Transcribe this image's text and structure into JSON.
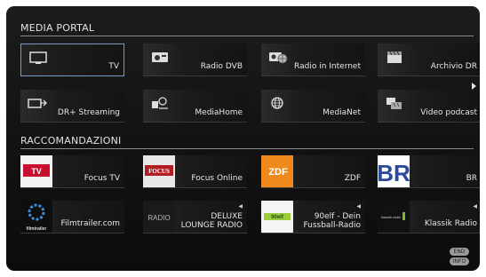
{
  "sections": {
    "portal_title": "MEDIA PORTAL",
    "recommend_title": "RACCOMANDAZIONI"
  },
  "portal_tiles": [
    {
      "label": "TV",
      "icon": "tv-icon"
    },
    {
      "label": "Radio DVB",
      "icon": "radio-icon"
    },
    {
      "label": "Radio in Internet",
      "icon": "internet-radio-icon"
    },
    {
      "label": "Archivio DR",
      "icon": "clapper-icon"
    },
    {
      "label": "DR+ Streaming",
      "icon": "streaming-icon"
    },
    {
      "label": "MediaHome",
      "icon": "mediahome-icon"
    },
    {
      "label": "MediaNet",
      "icon": "globe-icon"
    },
    {
      "label": "Video podcast",
      "icon": "podcast-icon"
    }
  ],
  "recommend_tiles": [
    {
      "label": "Focus TV",
      "thumb_text": "TV"
    },
    {
      "label": "Focus Online",
      "thumb_text": "FOCUS"
    },
    {
      "label": "ZDF",
      "thumb_text": "ZDF"
    },
    {
      "label": "BR",
      "thumb_text": "BR"
    },
    {
      "label": "Filmtrailer.com",
      "thumb_text": "filmtrailer"
    },
    {
      "label_line1": "DELUXE",
      "label_line2": "LOUNGE RADIO",
      "thumb_text": "RADIO"
    },
    {
      "label_line1": "90elf - Dein",
      "label_line2": "Fussball-Radio",
      "thumb_text": "90elf"
    },
    {
      "label": "Klassik Radio",
      "thumb_text": "klassik radio"
    }
  ],
  "footer": {
    "end_label": "END",
    "info_label": "INFO"
  },
  "colors": {
    "selection_border": "#7a9cc4",
    "zdf_orange": "#f08a1c",
    "br_blue": "#2a4a9c"
  }
}
